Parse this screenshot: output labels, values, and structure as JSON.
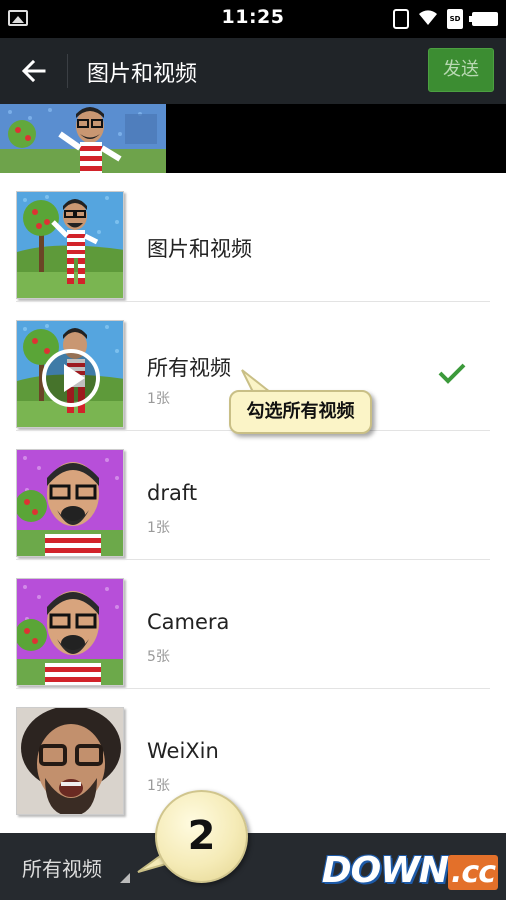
{
  "status_bar": {
    "time": "11:25",
    "icons": [
      "image-icon",
      "vibrate-icon",
      "wifi-icon",
      "sd-card-icon",
      "battery-icon"
    ],
    "sd_label": "SD"
  },
  "header": {
    "title": "图片和视频",
    "send_label": "发送",
    "accent_color": "#3c8d32"
  },
  "albums": [
    {
      "name": "图片和视频",
      "count": "",
      "thumb": "cartoon-blue",
      "selected": false,
      "has_play": false
    },
    {
      "name": "所有视频",
      "count": "1张",
      "thumb": "cartoon-blue",
      "selected": true,
      "has_play": true
    },
    {
      "name": "draft",
      "count": "1张",
      "thumb": "cartoon-purple",
      "selected": false,
      "has_play": false
    },
    {
      "name": "Camera",
      "count": "5张",
      "thumb": "cartoon-purple",
      "selected": false,
      "has_play": false
    },
    {
      "name": "WeiXin",
      "count": "1张",
      "thumb": "photo",
      "selected": false,
      "has_play": false
    }
  ],
  "annotations": {
    "callout": "勾选所有视频",
    "step_number": "2"
  },
  "footer": {
    "folder_label": "所有视频"
  },
  "watermark": {
    "main": "DOWN",
    "suffix": ".cc"
  }
}
